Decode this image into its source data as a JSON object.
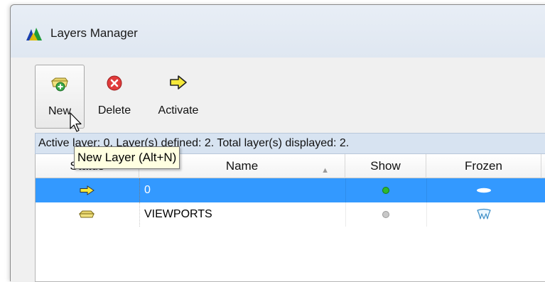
{
  "window": {
    "title": "Layers Manager"
  },
  "toolbar": {
    "new_label": "New",
    "delete_label": "Delete",
    "activate_label": "Activate"
  },
  "info_bar": {
    "text": "Active layer: 0. Layer(s) defined: 2. Total layer(s) displayed: 2."
  },
  "tooltip": {
    "text": "New Layer (Alt+N)"
  },
  "table": {
    "columns": [
      "Status",
      "Name",
      "Show",
      "Frozen"
    ],
    "rows": [
      {
        "status_icon": "active-arrow-icon",
        "name": "0",
        "show": "on",
        "frozen_icon": "sun-icon",
        "selected": true
      },
      {
        "status_icon": "layer-folder-icon",
        "name": "VIEWPORTS",
        "show": "off",
        "frozen_icon": "freeze-icon",
        "selected": false
      }
    ]
  },
  "colors": {
    "selection": "#3399ff",
    "info_bar": "#d7e3f1",
    "tooltip_bg": "#ffffe1",
    "show_on": "#2eb82e",
    "show_off": "#b0b0b0"
  }
}
